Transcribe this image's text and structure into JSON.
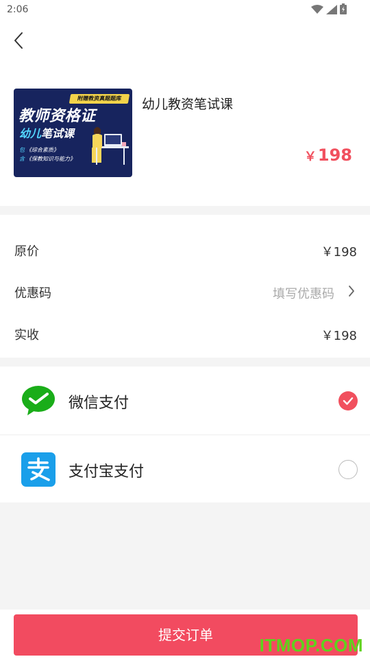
{
  "status_bar": {
    "time": "2:06",
    "icons": [
      "wifi-icon",
      "signal-icon",
      "battery-icon"
    ]
  },
  "nav": {
    "back_icon": "chevron-left-icon"
  },
  "product": {
    "name": "幼儿教资笔试课",
    "price_symbol": "￥",
    "price": "198",
    "thumbnail": {
      "banner": "附赠教资真题题库",
      "title": "教师资格证",
      "subtitle_accent": "幼儿",
      "subtitle_rest": "笔试课",
      "line1_mark": "包",
      "line1": "《综合素质》",
      "line2_mark": "含",
      "line2": "《保教知识与能力》"
    }
  },
  "summary": {
    "original_label": "原价",
    "original_value": "￥198",
    "coupon_label": "优惠码",
    "coupon_placeholder": "填写优惠码",
    "actual_label": "实收",
    "actual_value": "￥198"
  },
  "payments": [
    {
      "label": "微信支付",
      "icon": "wechat-pay-icon",
      "selected": true
    },
    {
      "label": "支付宝支付",
      "icon": "alipay-icon",
      "selected": false
    }
  ],
  "submit_label": "提交订单",
  "watermark": "ITMOP.COM",
  "colors": {
    "accent": "#f1505e",
    "wechat_green": "#1aad19",
    "alipay_blue": "#1a9fea",
    "watermark_green": "#5fd21d"
  }
}
